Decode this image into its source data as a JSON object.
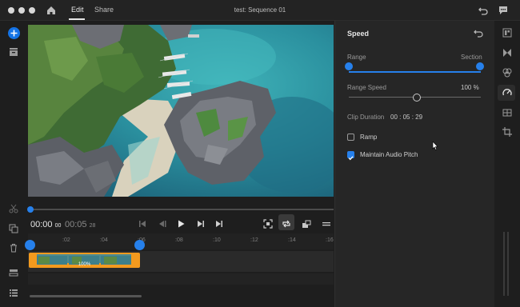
{
  "titlebar": {
    "tabs": [
      {
        "label": "Edit",
        "active": true
      },
      {
        "label": "Share",
        "active": false
      }
    ],
    "document_title": "test: Sequence 01"
  },
  "player": {
    "current_time": "00:00",
    "current_frames": "00",
    "duration_time": "00:05",
    "duration_frames": "28",
    "playhead_position": 0
  },
  "timeline": {
    "ruler_ticks": [
      ":02",
      ":04",
      ":06",
      ":08",
      ":10",
      ":12",
      ":14",
      ":16"
    ],
    "clip_speed_label": "100%"
  },
  "speed_panel": {
    "title": "Speed",
    "range_label": "Range",
    "section_label": "Section",
    "range_speed_label": "Range Speed",
    "range_speed_value": "100 %",
    "range_speed_position": 0.5,
    "clip_duration_label": "Clip Duration",
    "clip_duration_value": "00 : 05 : 29",
    "ramp": {
      "label": "Ramp",
      "checked": false
    },
    "maintain_audio_pitch": {
      "label": "Maintain Audio Pitch",
      "checked": true
    }
  },
  "colors": {
    "accent": "#2680eb",
    "clip": "#f39a1e",
    "background": "#1e1e1e",
    "panel": "#262626"
  },
  "icons": {
    "left_rail": [
      "add-icon",
      "library-icon",
      "scissors-icon",
      "duplicate-icon",
      "trash-icon",
      "track-icon",
      "list-icon"
    ],
    "transport": [
      "step-start-icon",
      "frame-back-icon",
      "play-icon",
      "frame-forward-icon",
      "step-end-icon"
    ],
    "right_rail": [
      "properties-icon",
      "transitions-icon",
      "color-icon",
      "speed-icon",
      "audio-icon",
      "crop-icon"
    ]
  }
}
